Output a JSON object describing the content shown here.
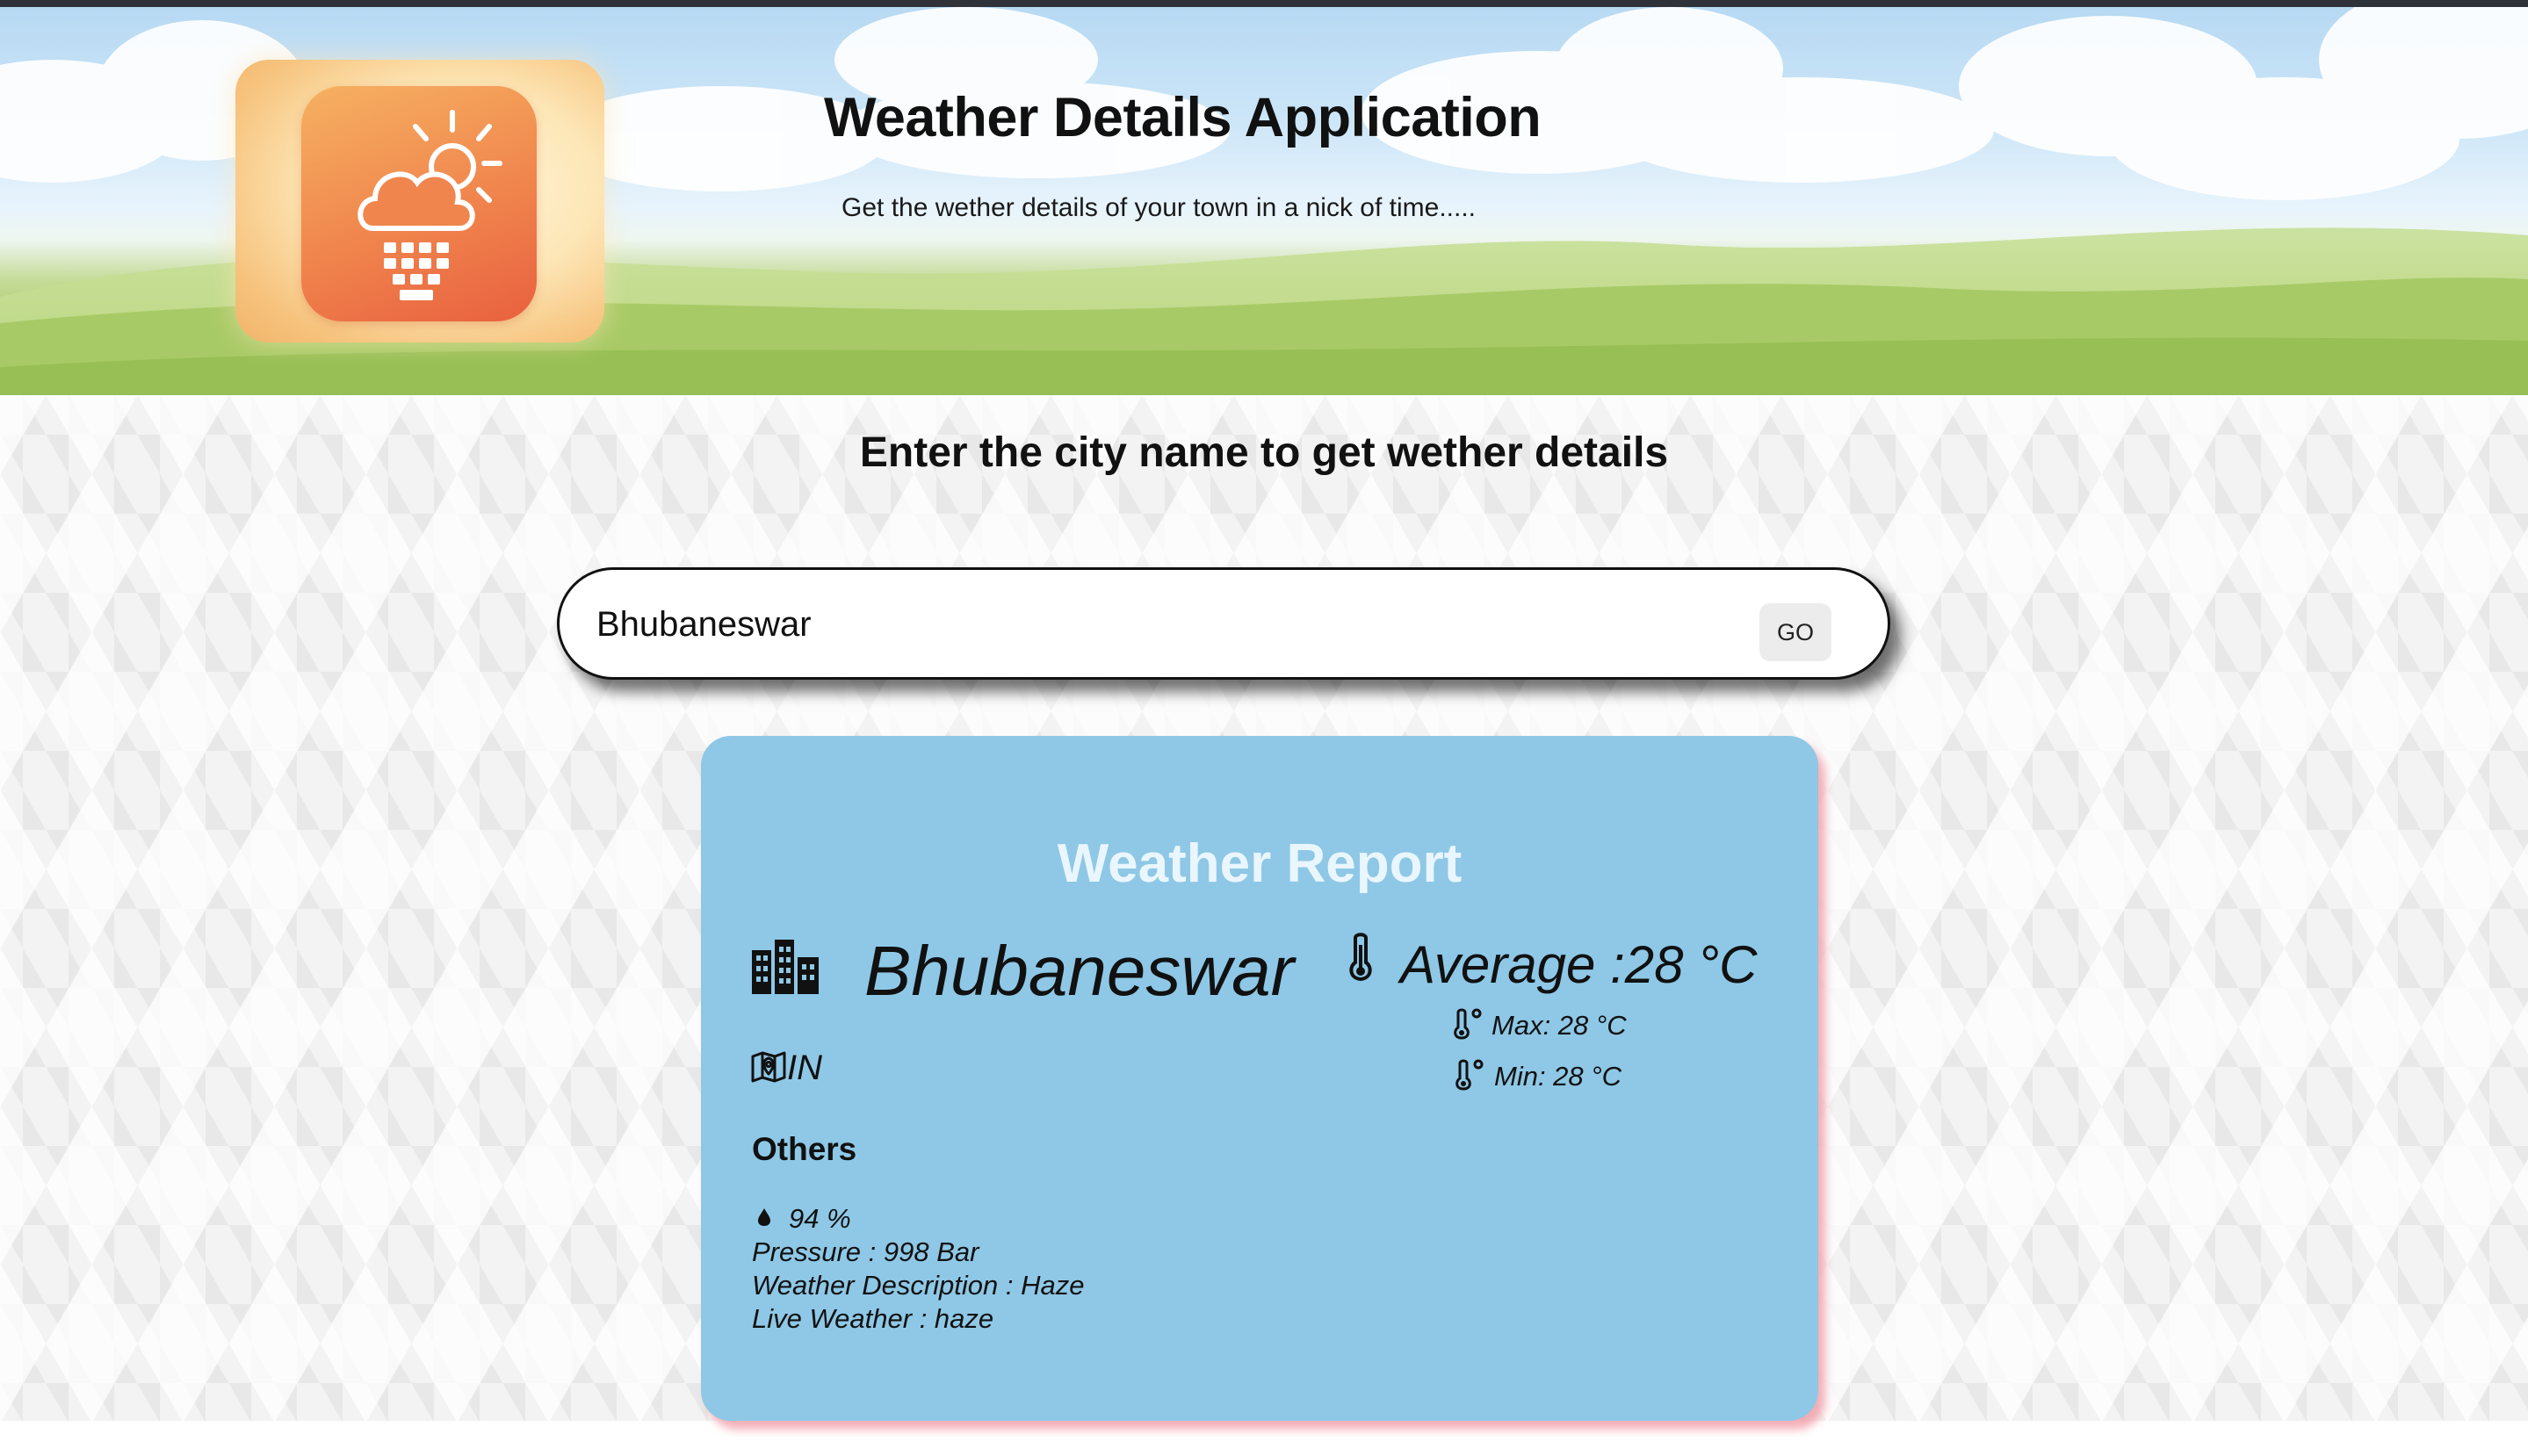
{
  "header": {
    "title": "Weather Details Application",
    "subtitle": "Get the wether details of your town in a nick of time....."
  },
  "search": {
    "prompt": "Enter the city name to get wether details",
    "value": "Bhubaneswar",
    "button_label": "GO"
  },
  "report": {
    "title": "Weather Report",
    "city": "Bhubaneswar",
    "country": "IN",
    "average": "Average :28 °C",
    "max": "Max: 28 °C",
    "min": "Min: 28 °C",
    "others_heading": "Others",
    "humidity": "94 %",
    "pressure": "Pressure : 998 Bar",
    "description": "Weather Description : Haze",
    "live": "Live Weather : haze"
  },
  "icons": {
    "logo": "weather-app-logo-icon",
    "city": "city-buildings-icon",
    "country": "map-location-icon",
    "average": "thermometer-icon",
    "max": "thermometer-sun-icon",
    "min": "thermometer-snow-icon",
    "humidity": "droplet-icon"
  },
  "colors": {
    "card_background": "#8ec8e6",
    "card_title": "#eaf6fd",
    "card_shadow": "#f0a0a8",
    "logo_orange": "#f0854d",
    "sky": "#b7d9f3",
    "grass": "#a6c865"
  }
}
